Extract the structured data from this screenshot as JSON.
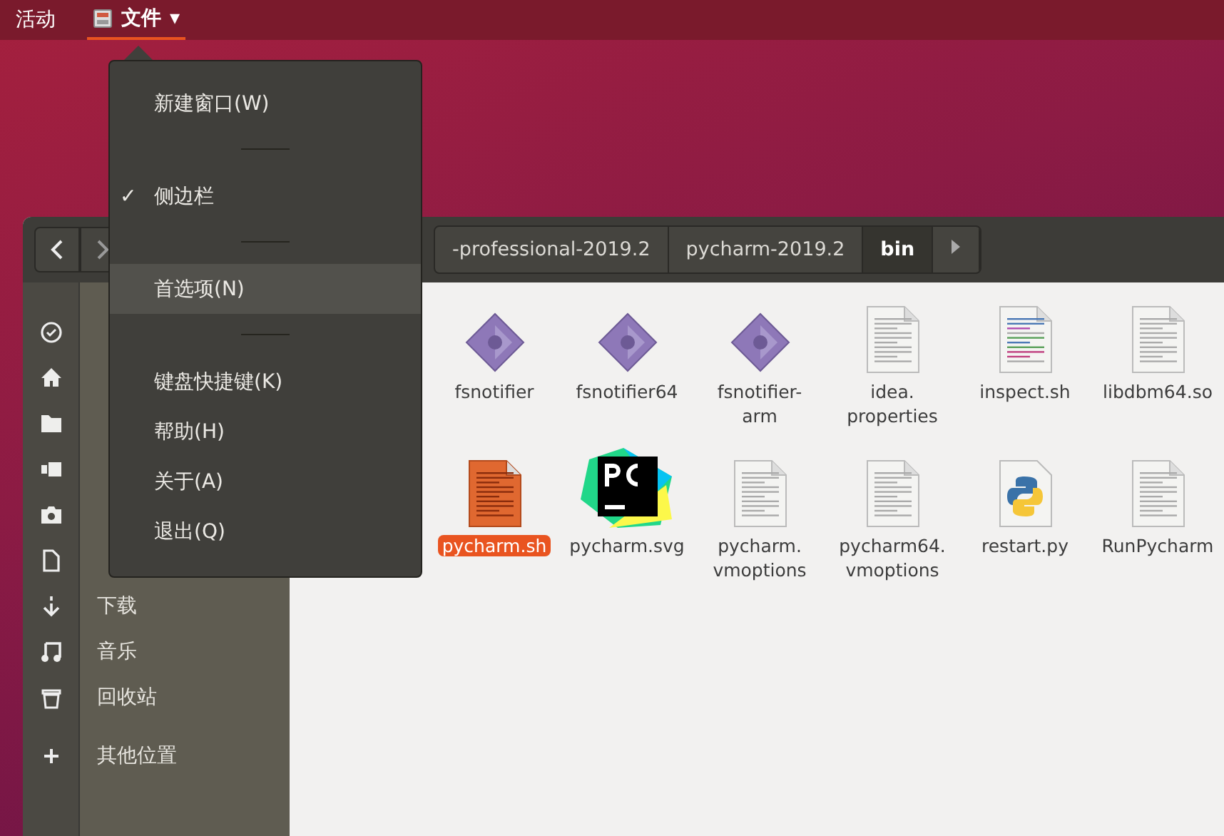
{
  "top_bar": {
    "activities": "活动",
    "app_menu": {
      "label": "文件",
      "caret": "▾",
      "open": true
    }
  },
  "check_mark": "✓",
  "app_menu_items": [
    {
      "kind": "item",
      "label": "新建窗口(W)",
      "checked": false,
      "hovered": false
    },
    {
      "kind": "separator"
    },
    {
      "kind": "item",
      "label": "侧边栏",
      "checked": true,
      "hovered": false
    },
    {
      "kind": "separator"
    },
    {
      "kind": "item",
      "label": "首选项(N)",
      "checked": false,
      "hovered": true
    },
    {
      "kind": "separator"
    },
    {
      "kind": "item",
      "label": "键盘快捷键(K)",
      "checked": false,
      "hovered": false
    },
    {
      "kind": "item",
      "label": "帮助(H)",
      "checked": false,
      "hovered": false
    },
    {
      "kind": "item",
      "label": "关于(A)",
      "checked": false,
      "hovered": false
    },
    {
      "kind": "item",
      "label": "退出(Q)",
      "checked": false,
      "hovered": false
    }
  ],
  "path_bar": [
    {
      "label": "-professional-2019.2",
      "selected": false
    },
    {
      "label": "pycharm-2019.2",
      "selected": false
    },
    {
      "label": "bin",
      "selected": true
    }
  ],
  "sidebar": {
    "items": [
      {
        "selected": false
      },
      {
        "selected": false
      },
      {
        "selected": false
      },
      {
        "selected": false
      },
      {
        "selected": false
      },
      {
        "selected": false
      },
      {
        "label": "下载",
        "selected": false
      },
      {
        "label": "音乐",
        "selected": false
      },
      {
        "label": "回收站",
        "selected": false
      },
      {
        "label": "其他位置",
        "selected": false
      }
    ]
  },
  "files": [
    {
      "kind": "executable",
      "name": "fsnotifier",
      "selected": false
    },
    {
      "kind": "executable",
      "name": "fsnotifier64",
      "selected": false
    },
    {
      "kind": "executable",
      "name": "fsnotifier-arm",
      "selected": false
    },
    {
      "kind": "text",
      "name": "idea.properties",
      "selected": false
    },
    {
      "kind": "script",
      "name": "inspect.sh",
      "selected": false
    },
    {
      "kind": "text",
      "name": "libdbm64.so",
      "selected": false
    },
    {
      "kind": "shell",
      "name": "pycharm.sh",
      "selected": true
    },
    {
      "kind": "logo",
      "name": "pycharm.svg",
      "selected": false
    },
    {
      "kind": "text",
      "name": "pycharm.vmoptions",
      "selected": false
    },
    {
      "kind": "text",
      "name": "pycharm64.vmoptions",
      "selected": false
    },
    {
      "kind": "python",
      "name": "restart.py",
      "selected": false
    },
    {
      "kind": "text",
      "name": "RunPycharm",
      "selected": false
    }
  ]
}
